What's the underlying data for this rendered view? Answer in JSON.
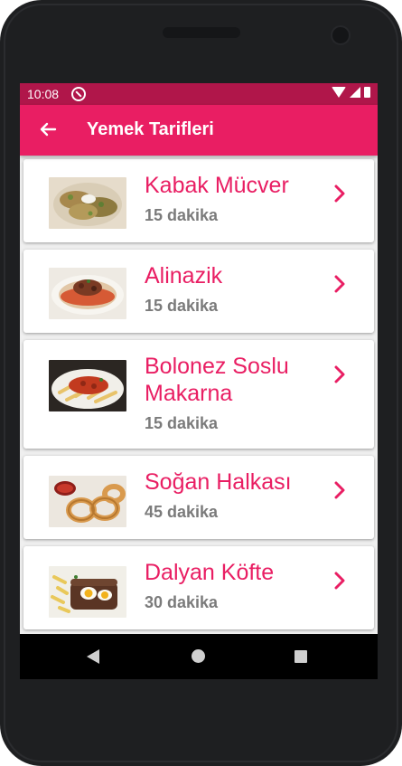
{
  "statusbar": {
    "time": "10:08",
    "icons": [
      "app-notification-icon",
      "wifi-icon",
      "signal-icon",
      "battery-icon"
    ]
  },
  "appbar": {
    "title": "Yemek Tarifleri",
    "back_icon": "arrow-left-icon"
  },
  "colors": {
    "primary": "#e91e63",
    "primary_dark": "#b0164a",
    "time_text": "#7b7b7b"
  },
  "recipes": [
    {
      "name": "Kabak Mücver",
      "time": "15 dakika",
      "image": "kabak-mucver-photo"
    },
    {
      "name": "Alinazik",
      "time": "15 dakika",
      "image": "alinazik-photo"
    },
    {
      "name": "Bolonez Soslu Makarna",
      "time": "15 dakika",
      "image": "bolonez-makarna-photo"
    },
    {
      "name": "Soğan Halkası",
      "time": "45 dakika",
      "image": "sogan-halkasi-photo"
    },
    {
      "name": "Dalyan Köfte",
      "time": "30 dakika",
      "image": "dalyan-kofte-photo"
    }
  ],
  "navbar": {
    "icons": [
      "back-icon",
      "home-icon",
      "recents-icon"
    ]
  }
}
